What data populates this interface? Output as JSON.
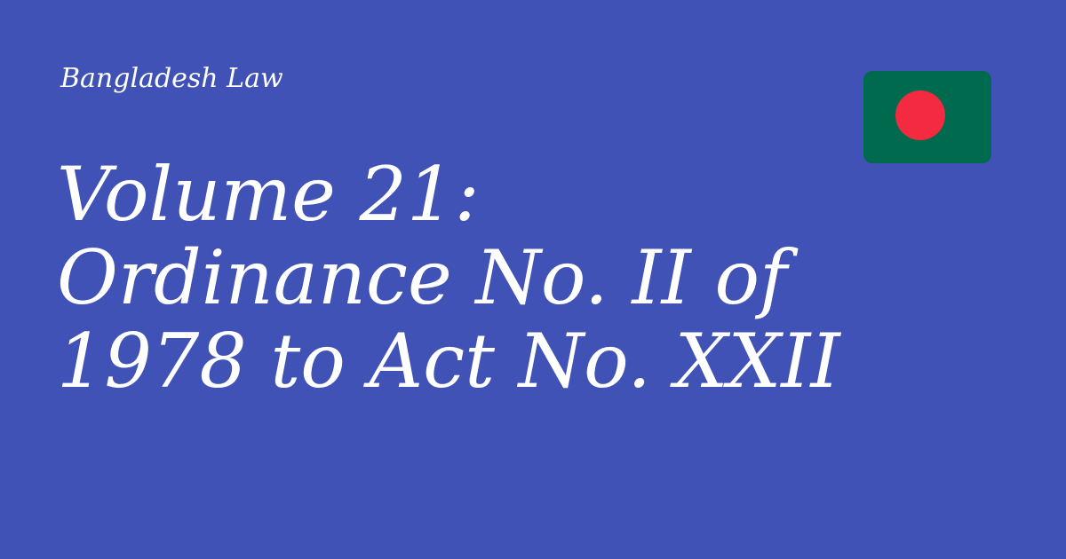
{
  "eyebrow": "Bangladesh Law",
  "title_lines": [
    "Volume 21:",
    "Ordinance No. II of",
    "1978 to Act No. XXII"
  ],
  "flag": {
    "icon": "bangladesh-flag-icon",
    "field_color": "#006a4e",
    "disc_color": "#f42a41"
  },
  "colors": {
    "background": "#4052b5",
    "text": "#ffffff"
  }
}
